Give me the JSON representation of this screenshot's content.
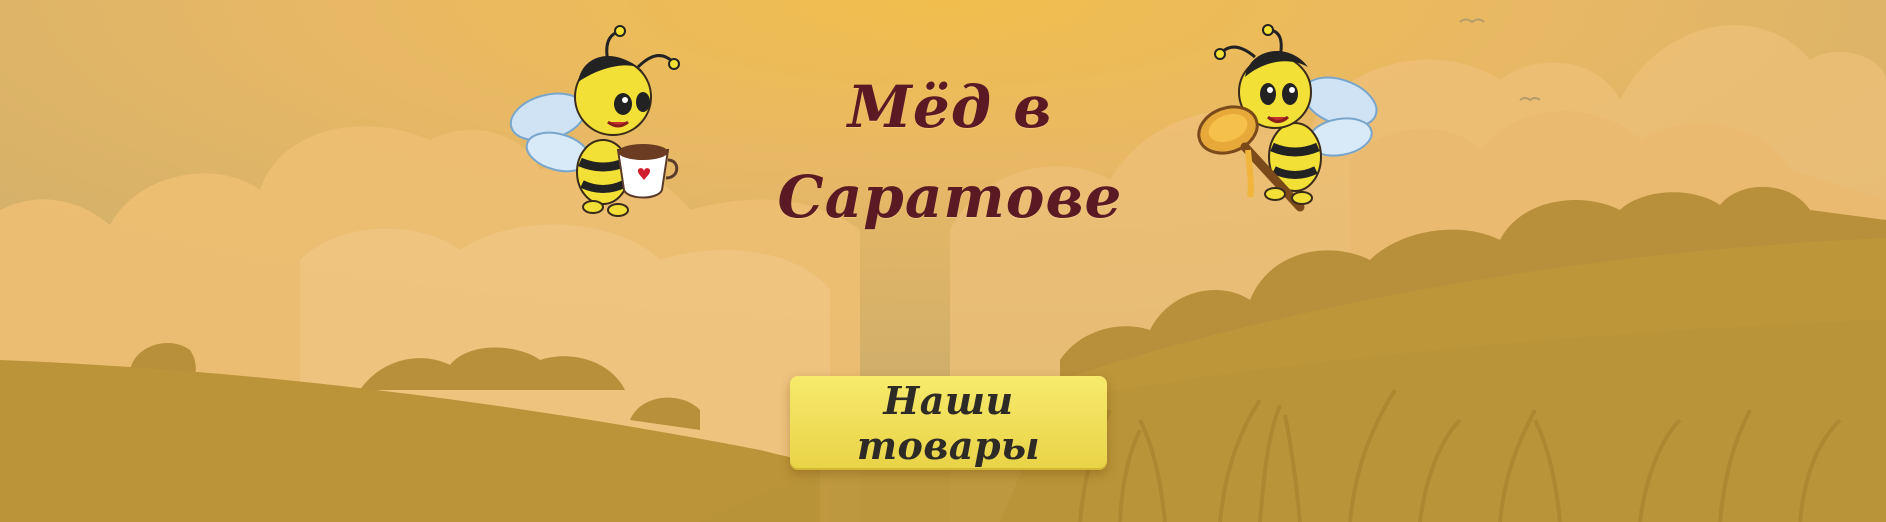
{
  "header": {
    "title": "Мёд в Саратове"
  },
  "hero": {
    "cta_label": "Наши товары"
  },
  "illustrations": {
    "left_bee": "bee-with-cup-icon",
    "right_bee": "bee-with-honey-spoon-icon"
  },
  "colors": {
    "title": "#5a1a24",
    "button": "#f2e25a",
    "button_text": "#2e2a26",
    "sky": "#e6b35a",
    "hills": "#b8923c"
  }
}
